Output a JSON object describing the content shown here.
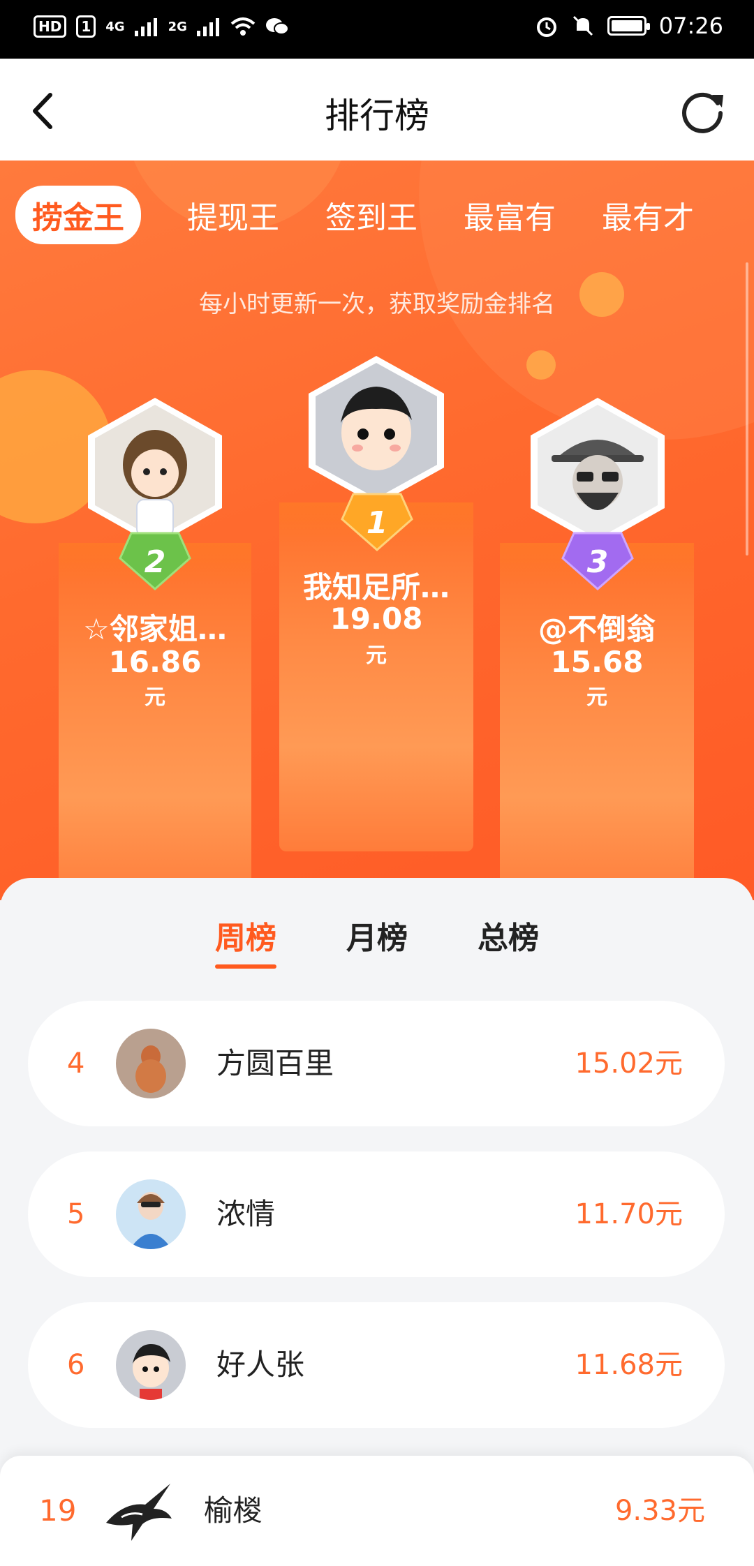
{
  "status_bar": {
    "badges": [
      "HD",
      "1",
      "4G",
      "2G"
    ],
    "time": "07:26",
    "icons": [
      "signal-icon",
      "wifi-icon",
      "wechat-icon",
      "alarm-icon",
      "mute-icon",
      "battery-icon"
    ],
    "battery_level": 0.9
  },
  "header": {
    "title": "排行榜",
    "back_icon": "back-arrow-icon",
    "refresh_icon": "refresh-icon"
  },
  "category_tabs": [
    "捞金王",
    "提现王",
    "签到王",
    "最富有",
    "最有才"
  ],
  "active_category": "捞金王",
  "subtitle": "每小时更新一次，获取奖励金排名",
  "podium": [
    {
      "rank": "1",
      "name": "我知足所…",
      "amount": "19.08",
      "unit": "元",
      "badge_color": "#ffa726"
    },
    {
      "rank": "2",
      "name": "☆邻家姐…",
      "amount": "16.86",
      "unit": "元",
      "badge_color": "#6cc24a"
    },
    {
      "rank": "3",
      "name": "@不倒翁",
      "amount": "15.68",
      "unit": "元",
      "badge_color": "#a26bf0"
    }
  ],
  "period_tabs": [
    "周榜",
    "月榜",
    "总榜"
  ],
  "active_period": "周榜",
  "ranking_list": [
    {
      "rank": "4",
      "name": "方圆百里",
      "amount": "15.02元"
    },
    {
      "rank": "5",
      "name": "浓情",
      "amount": "11.70元"
    },
    {
      "rank": "6",
      "name": "好人张",
      "amount": "11.68元"
    }
  ],
  "my_rank": {
    "rank": "19",
    "name": "榆椶",
    "amount": "9.33元"
  },
  "colors": {
    "accent": "#ff5a1f",
    "hero": "#ff6a2e",
    "text": "#222222"
  }
}
